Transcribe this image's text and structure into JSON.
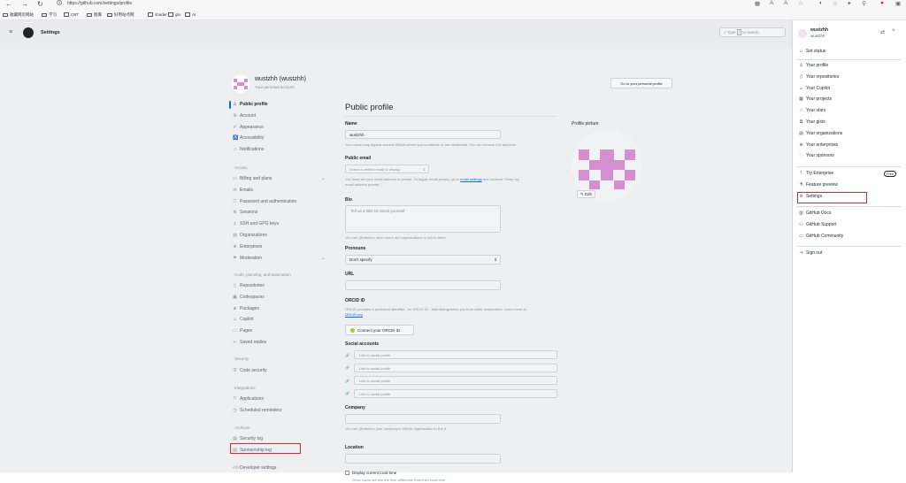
{
  "browser": {
    "url": "https://github.com/settings/profile",
    "bookmarks": [
      "收藏网页网站",
      "学习",
      "CBT",
      "图库",
      "好用站点网",
      "shader",
      "glo",
      "AI"
    ]
  },
  "header": {
    "title": "Settings",
    "search_placeholder": "Type",
    "search_key": "/",
    "search_suffix": "to search"
  },
  "user": {
    "display": "wustzhh (wustzhh)",
    "subtitle": "Your personal account",
    "goto_label": "Go to your personal profile"
  },
  "sidebar": {
    "top": [
      {
        "icon": "person",
        "label": "Public profile",
        "selected": true
      },
      {
        "icon": "gear",
        "label": "Account"
      },
      {
        "icon": "paintbrush",
        "label": "Appearance"
      },
      {
        "icon": "accessibility",
        "label": "Accessibility"
      },
      {
        "icon": "bell",
        "label": "Notifications"
      }
    ],
    "access_title": "Access",
    "access": [
      {
        "icon": "credit-card",
        "label": "Billing and plans",
        "chevron": true
      },
      {
        "icon": "mail",
        "label": "Emails"
      },
      {
        "icon": "shield",
        "label": "Password and authentication"
      },
      {
        "icon": "broadcast",
        "label": "Sessions"
      },
      {
        "icon": "key",
        "label": "SSH and GPG keys"
      },
      {
        "icon": "organization",
        "label": "Organizations"
      },
      {
        "icon": "globe",
        "label": "Enterprises"
      },
      {
        "icon": "report",
        "label": "Moderation",
        "chevron": true
      }
    ],
    "code_title": "Code, planning, and automation",
    "code": [
      {
        "icon": "repo",
        "label": "Repositories"
      },
      {
        "icon": "codespaces",
        "label": "Codespaces"
      },
      {
        "icon": "package",
        "label": "Packages"
      },
      {
        "icon": "copilot",
        "label": "Copilot"
      },
      {
        "icon": "browser",
        "label": "Pages"
      },
      {
        "icon": "reply",
        "label": "Saved replies"
      }
    ],
    "security_title": "Security",
    "security": [
      {
        "icon": "shield-lock",
        "label": "Code security"
      }
    ],
    "integrations_title": "Integrations",
    "integrations": [
      {
        "icon": "apps",
        "label": "Applications"
      },
      {
        "icon": "clock",
        "label": "Scheduled reminders"
      }
    ],
    "archives_title": "Archives",
    "archives": [
      {
        "icon": "log",
        "label": "Security log"
      },
      {
        "icon": "log",
        "label": "Sponsorship log"
      }
    ],
    "developer": "Developer settings"
  },
  "profile": {
    "heading": "Public profile",
    "name_label": "Name",
    "name_value": "wustzhh",
    "name_hint": "Your name may appear around GitHub where you contribute or are mentioned. You can remove it at any time.",
    "email_label": "Public email",
    "email_select": "Select a verified email to display",
    "email_hint_1": "You have set your email address to private. To toggle email privacy, go to",
    "email_hint_link": "email settings",
    "email_hint_2": "and uncheck \"Keep my",
    "email_hint_3": "email address private.\"",
    "bio_label": "Bio",
    "bio_placeholder": "Tell us a little bit about yourself",
    "bio_hint": "You can @mention other users and organizations to link to them.",
    "pronouns_label": "Pronouns",
    "pronouns_value": "Don't specify",
    "url_label": "URL",
    "orcid_label": "ORCID iD",
    "orcid_hint": "ORCID provides a persistent identifier - an ORCID iD - that distinguishes you from other researchers. Learn more at",
    "orcid_link": "ORCID.org",
    "orcid_button": "Connect your ORCID iD",
    "social_label": "Social accounts",
    "social_placeholder": "Link to social profile",
    "company_label": "Company",
    "company_hint": "You can @mention your company's GitHub organization to link it.",
    "location_label": "Location",
    "localtime_label": "Display current local time",
    "localtime_hint": "Other users will see the time difference from their local time.",
    "picture_label": "Profile picture",
    "edit_label": "Edit"
  },
  "drawer": {
    "username": "wustzhh",
    "login": "wustzhh",
    "set_status": "Set status",
    "group1": [
      {
        "icon": "person",
        "label": "Your profile"
      },
      {
        "icon": "repo",
        "label": "Your repositories"
      },
      {
        "icon": "copilot",
        "label": "Your Copilot"
      },
      {
        "icon": "table",
        "label": "Your projects"
      },
      {
        "icon": "star",
        "label": "Your stars"
      },
      {
        "icon": "code-square",
        "label": "Your gists"
      },
      {
        "icon": "organization",
        "label": "Your organizations"
      },
      {
        "icon": "globe",
        "label": "Your enterprises"
      },
      {
        "icon": "heart",
        "label": "Your sponsors"
      }
    ],
    "group2": [
      {
        "icon": "upload",
        "label": "Try Enterprise",
        "badge": "Free"
      },
      {
        "icon": "beaker",
        "label": "Feature preview"
      },
      {
        "icon": "gear",
        "label": "Settings"
      }
    ],
    "group3": [
      {
        "icon": "book",
        "label": "GitHub Docs"
      },
      {
        "icon": "people",
        "label": "GitHub Support"
      },
      {
        "icon": "comment",
        "label": "GitHub Community"
      }
    ],
    "sign_out": "Sign out"
  },
  "colors": {
    "accent": "#0969da",
    "highlight": "#e0242b",
    "avatar": "#d58fd0"
  }
}
